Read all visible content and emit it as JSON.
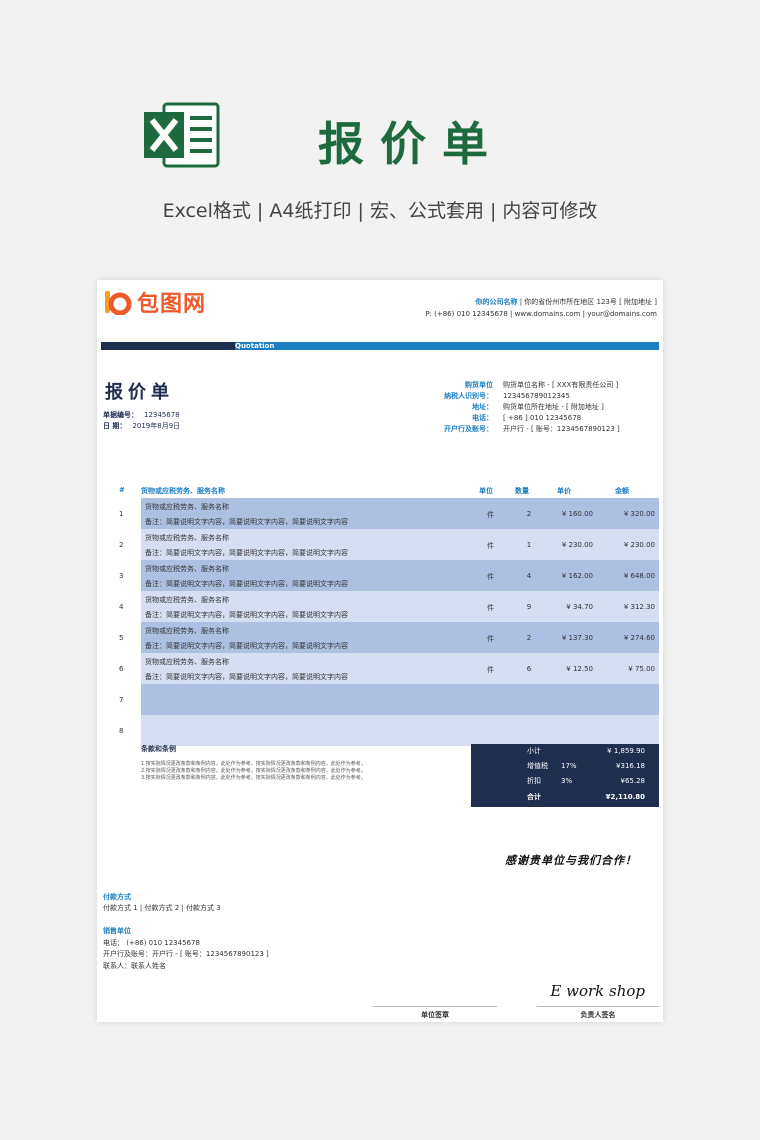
{
  "hero": {
    "title": "报价单",
    "subtitle": "Excel格式 |  A4纸打印 | 宏、公式套用 | 内容可修改",
    "icon": "excel-icon"
  },
  "paper": {
    "logo_text": "包图网",
    "company": {
      "name": "你的公司名称",
      "address": "|  你的省份州市所在地区 123号 [ 附加地址 ]",
      "contact": "P:   (+86)  010 12345678   |  www.domains.com   |  your@domains.com"
    },
    "band_label": "Quotation",
    "doc_title": "报价单",
    "meta": [
      {
        "label": "单据编号：",
        "value": "12345678"
      },
      {
        "label": "日    期：",
        "value": "2019年8月9日"
      }
    ],
    "buyer": [
      {
        "label": "购货单位",
        "value": "购货单位名称 - [ XXX有限责任公司 ]"
      },
      {
        "label": "纳税人识别号：",
        "value": "123456789012345"
      },
      {
        "label": "地址：",
        "value": "购货单位所在地址 - [ 附加地址 ]"
      },
      {
        "label": "电话：",
        "value": "[ +86 ] 010 12345678"
      },
      {
        "label": "开户行及账号：",
        "value": "开户行 - [ 账号：1234567890123 ]"
      }
    ],
    "table": {
      "headers": {
        "num": "#",
        "name": "货物或应税劳务、服务名称",
        "unit": "单位",
        "qty": "数量",
        "price": "单价",
        "amount": "金额"
      },
      "rows": [
        {
          "num": "1",
          "name": "货物或应税劳务、服务名称",
          "note": "备注：简要说明文字内容，简要说明文字内容，简要说明文字内容",
          "unit": "件",
          "qty": "2",
          "price": "¥ 160.00",
          "amount": "¥ 320.00"
        },
        {
          "num": "2",
          "name": "货物或应税劳务、服务名称",
          "note": "备注：简要说明文字内容，简要说明文字内容，简要说明文字内容",
          "unit": "件",
          "qty": "1",
          "price": "¥ 230.00",
          "amount": "¥ 230.00"
        },
        {
          "num": "3",
          "name": "货物或应税劳务、服务名称",
          "note": "备注：简要说明文字内容，简要说明文字内容，简要说明文字内容",
          "unit": "件",
          "qty": "4",
          "price": "¥ 162.00",
          "amount": "¥ 648.00"
        },
        {
          "num": "4",
          "name": "货物或应税劳务、服务名称",
          "note": "备注：简要说明文字内容，简要说明文字内容，简要说明文字内容",
          "unit": "件",
          "qty": "9",
          "price": "¥ 34.70",
          "amount": "¥ 312.30"
        },
        {
          "num": "5",
          "name": "货物或应税劳务、服务名称",
          "note": "备注：简要说明文字内容，简要说明文字内容，简要说明文字内容",
          "unit": "件",
          "qty": "2",
          "price": "¥ 137.30",
          "amount": "¥ 274.60"
        },
        {
          "num": "6",
          "name": "货物或应税劳务、服务名称",
          "note": "备注：简要说明文字内容，简要说明文字内容，简要说明文字内容",
          "unit": "件",
          "qty": "6",
          "price": "¥ 12.50",
          "amount": "¥ 75.00"
        },
        {
          "num": "7",
          "name": "",
          "note": "",
          "unit": "",
          "qty": "",
          "price": "",
          "amount": ""
        },
        {
          "num": "8",
          "name": "",
          "note": "",
          "unit": "",
          "qty": "",
          "price": "",
          "amount": ""
        }
      ]
    },
    "terms": {
      "title": "条款和条例",
      "lines": [
        "1.按实际情况更改条款和条例内容，此处作为参考。按实际情况更改条款和条例内容，此处作为参考。",
        "2.按实际情况更改条款和条例内容，此处作为参考。按实际情况更改条款和条例内容，此处作为参考。",
        "3.按实际情况更改条款和条例内容，此处作为参考。按实际情况更改条款和条例内容，此处作为参考。"
      ]
    },
    "totals": {
      "subtotal_label": "小计",
      "subtotal": "¥ 1,859.90",
      "vat_label": "增值税",
      "vat_pct": "17%",
      "vat": "¥316.18",
      "discount_label": "折扣",
      "discount_pct": "3%",
      "discount": "¥65.28",
      "total_label": "合计",
      "total": "¥2,110.80"
    },
    "thanks": "感谢贵单位与我们合作！",
    "payment": {
      "title": "付款方式",
      "methods": "付款方式 1 | 付款方式 2 | 付款方式 3"
    },
    "seller": {
      "title": "销售单位",
      "phone": "电话：   (+86)  010 12345678",
      "bank": "开户行及账号：开户行 - [ 账号：1234567890123 ]",
      "contact": "联系人：联系人姓名"
    },
    "signature_script": "E work shop",
    "sig_unit_label": "单位签章",
    "sig_person_label": "负责人签名"
  }
}
